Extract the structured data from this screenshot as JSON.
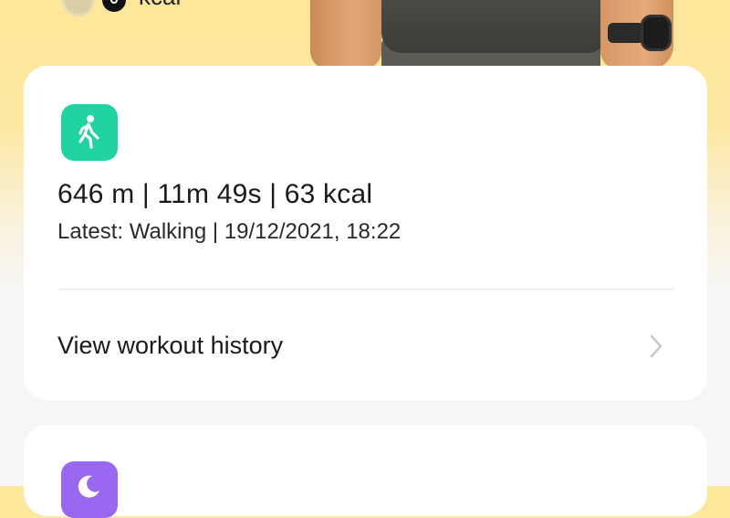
{
  "hero": {
    "unit": "kcal"
  },
  "workout": {
    "summary": "646 m | 11m 49s | 63 kcal",
    "latest": "Latest: Walking | 19/12/2021, 18:22",
    "history_label": "View workout history"
  },
  "colors": {
    "walk_icon_bg": "#1fd4a0",
    "sleep_icon_bg": "#9a67f0",
    "card_bg": "#ffffff",
    "header_bg": "#fde79a"
  },
  "icons": {
    "workout": "walking-person-icon",
    "history_arrow": "chevron-right-icon",
    "sleep": "moon-icon"
  }
}
